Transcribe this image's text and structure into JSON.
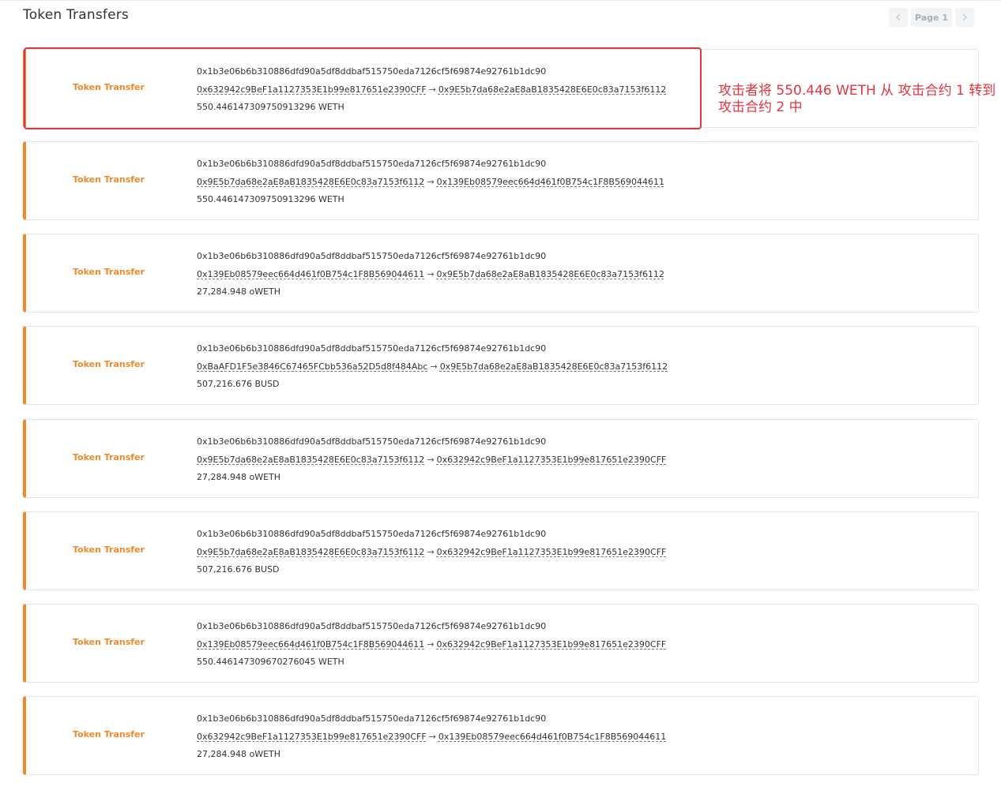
{
  "page_title": "Token Transfers",
  "pagination": {
    "label": "Page 1",
    "prev_icon": "chevron-left-icon",
    "next_icon": "chevron-right-icon"
  },
  "colors": {
    "accent": "#f0892a",
    "highlight": "#e3343f",
    "border": "#e3e6ea"
  },
  "transfers": [
    {
      "type": "Token Transfer",
      "tx_hash": "0x1b3e06b6b310886dfd90a5df8ddbaf515750eda7126cf5f69874e92761b1dc90",
      "from": "0x632942c9BeF1a1127353E1b99e817651e2390CFF",
      "to": "0x9E5b7da68e2aE8aB1835428E6E0c83a7153f6112",
      "amount": "550.446147309750913296 WETH"
    },
    {
      "type": "Token Transfer",
      "tx_hash": "0x1b3e06b6b310886dfd90a5df8ddbaf515750eda7126cf5f69874e92761b1dc90",
      "from": "0x9E5b7da68e2aE8aB1835428E6E0c83a7153f6112",
      "to": "0x139Eb08579eec664d461f0B754c1F8B569044611",
      "amount": "550.446147309750913296 WETH"
    },
    {
      "type": "Token Transfer",
      "tx_hash": "0x1b3e06b6b310886dfd90a5df8ddbaf515750eda7126cf5f69874e92761b1dc90",
      "from": "0x139Eb08579eec664d461f0B754c1F8B569044611",
      "to": "0x9E5b7da68e2aE8aB1835428E6E0c83a7153f6112",
      "amount": "27,284.948 oWETH"
    },
    {
      "type": "Token Transfer",
      "tx_hash": "0x1b3e06b6b310886dfd90a5df8ddbaf515750eda7126cf5f69874e92761b1dc90",
      "from": "0xBaAFD1F5e3846C67465FCbb536a52D5d8f484Abc",
      "to": "0x9E5b7da68e2aE8aB1835428E6E0c83a7153f6112",
      "amount": "507,216.676 BUSD"
    },
    {
      "type": "Token Transfer",
      "tx_hash": "0x1b3e06b6b310886dfd90a5df8ddbaf515750eda7126cf5f69874e92761b1dc90",
      "from": "0x9E5b7da68e2aE8aB1835428E6E0c83a7153f6112",
      "to": "0x632942c9BeF1a1127353E1b99e817651e2390CFF",
      "amount": "27,284.948 oWETH"
    },
    {
      "type": "Token Transfer",
      "tx_hash": "0x1b3e06b6b310886dfd90a5df8ddbaf515750eda7126cf5f69874e92761b1dc90",
      "from": "0x9E5b7da68e2aE8aB1835428E6E0c83a7153f6112",
      "to": "0x632942c9BeF1a1127353E1b99e817651e2390CFF",
      "amount": "507,216.676 BUSD"
    },
    {
      "type": "Token Transfer",
      "tx_hash": "0x1b3e06b6b310886dfd90a5df8ddbaf515750eda7126cf5f69874e92761b1dc90",
      "from": "0x139Eb08579eec664d461f0B754c1F8B569044611",
      "to": "0x632942c9BeF1a1127353E1b99e817651e2390CFF",
      "amount": "550.446147309670276045 WETH"
    },
    {
      "type": "Token Transfer",
      "tx_hash": "0x1b3e06b6b310886dfd90a5df8ddbaf515750eda7126cf5f69874e92761b1dc90",
      "from": "0x632942c9BeF1a1127353E1b99e817651e2390CFF",
      "to": "0x139Eb08579eec664d461f0B754c1F8B569044611",
      "amount": "27,284.948 oWETH"
    }
  ],
  "annotation": {
    "text": "攻击者将 550.446 WETH 从 攻击合约 1 转到 攻击合约 2 中"
  }
}
